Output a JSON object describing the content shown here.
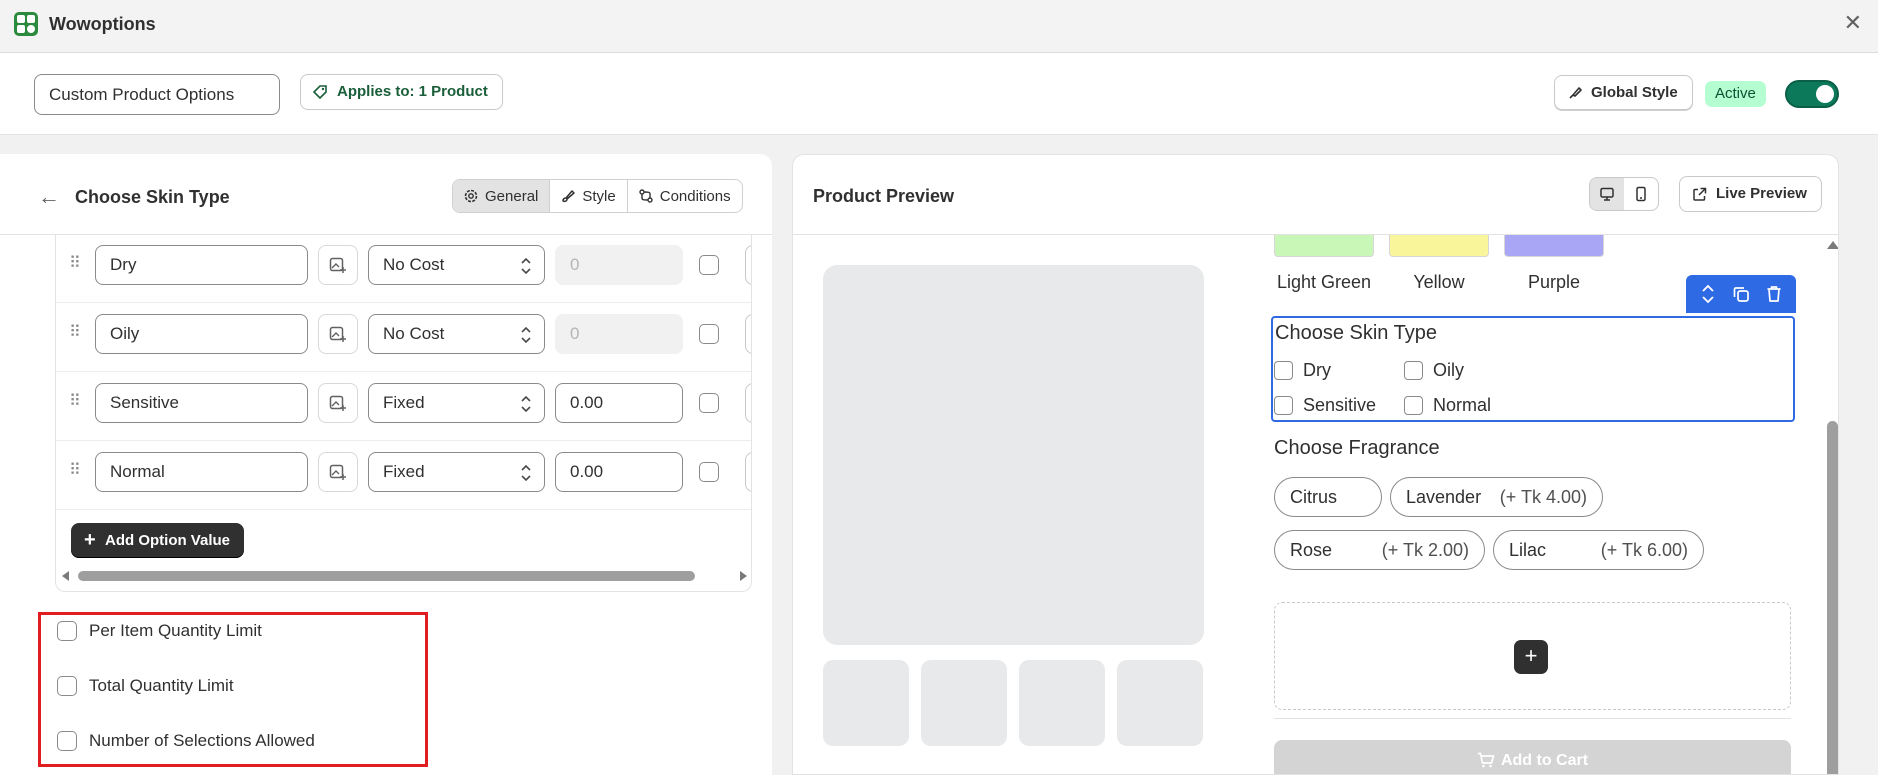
{
  "app": {
    "title": "Wowoptions"
  },
  "topbar": {
    "option_set_name": "Custom Product Options",
    "applies_to": "Applies to: 1 Product",
    "global_style": "Global Style",
    "status": "Active",
    "active_toggle_on": true
  },
  "editor": {
    "title": "Choose Skin Type",
    "tabs": [
      {
        "label": "General",
        "icon": "gear-icon",
        "active": true
      },
      {
        "label": "Style",
        "icon": "brush-icon",
        "active": false
      },
      {
        "label": "Conditions",
        "icon": "branch-icon",
        "active": false
      }
    ],
    "values": [
      {
        "name": "Dry",
        "cost_type": "No Cost",
        "price": "0",
        "price_disabled": true
      },
      {
        "name": "Oily",
        "cost_type": "No Cost",
        "price": "0",
        "price_disabled": true
      },
      {
        "name": "Sensitive",
        "cost_type": "Fixed",
        "price": "0.00",
        "price_disabled": false
      },
      {
        "name": "Normal",
        "cost_type": "Fixed",
        "price": "0.00",
        "price_disabled": false
      }
    ],
    "add_value_label": "Add Option Value",
    "limits": [
      {
        "label": "Per Item Quantity Limit",
        "checked": false
      },
      {
        "label": "Total Quantity Limit",
        "checked": false
      },
      {
        "label": "Number of Selections Allowed",
        "checked": false
      }
    ]
  },
  "preview": {
    "title": "Product Preview",
    "live_preview": "Live Preview",
    "colors": [
      {
        "label": "Light Green",
        "hex": "#c9f7b8"
      },
      {
        "label": "Yellow",
        "hex": "#f9f59a"
      },
      {
        "label": "Purple",
        "hex": "#a9a7f5"
      }
    ],
    "skin_block": {
      "title": "Choose Skin Type",
      "options": [
        "Dry",
        "Oily",
        "Sensitive",
        "Normal"
      ]
    },
    "fragrance": {
      "title": "Choose Fragrance",
      "chips": [
        {
          "name": "Citrus",
          "extra": ""
        },
        {
          "name": "Lavender",
          "extra": "(+ Tk 4.00)"
        },
        {
          "name": "Rose",
          "extra": "(+ Tk 2.00)"
        },
        {
          "name": "Lilac",
          "extra": "(+ Tk 6.00)"
        }
      ]
    },
    "add_block_symbol": "+",
    "add_to_cart": "Add to Cart"
  },
  "colors": {
    "accent_blue": "#2f6ae5",
    "toggle_green": "#0c7a5a",
    "highlight_red": "#e11d22"
  }
}
